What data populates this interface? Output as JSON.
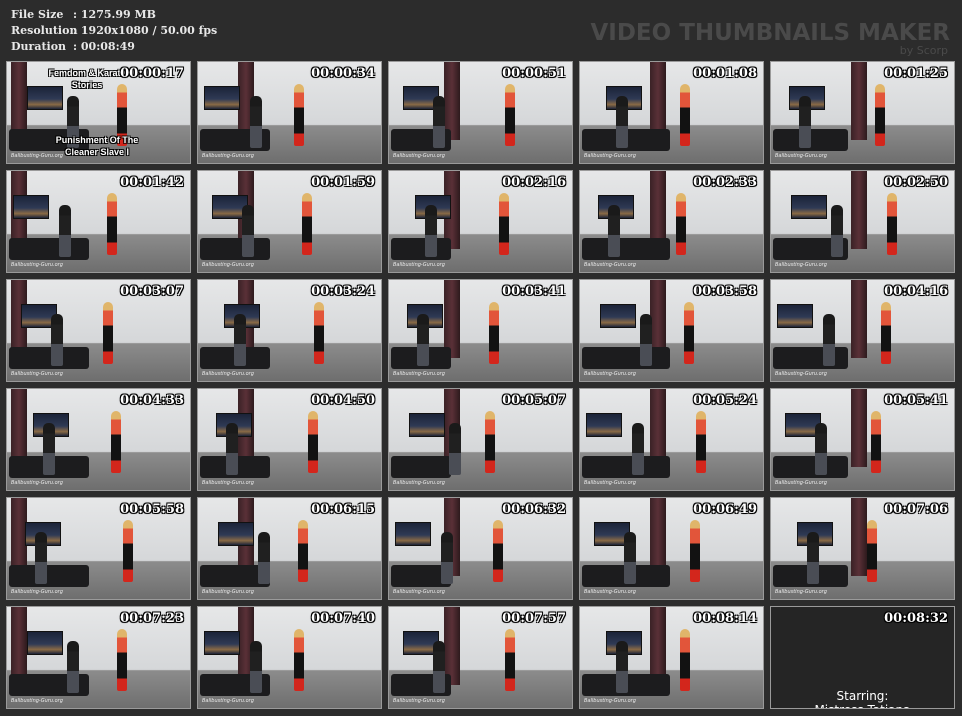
{
  "file_info": {
    "file_size_label": "File Size",
    "file_size_value": ": 1275.99 MB",
    "resolution_label": "Resolution",
    "resolution_value": ": 1920x1080 / 50.00 fps",
    "duration_label": "Duration",
    "duration_value": ": 00:08:49"
  },
  "watermark": {
    "title": "VIDEO THUMBNAILS MAKER",
    "subtitle": "by Scorp"
  },
  "first_thumb_overlay": {
    "line1": "Femdom & Karate",
    "line2": "Stories",
    "line3": "Punishment Of The",
    "line4": "Cleaner Slave I"
  },
  "site_watermark": "Ballbusting-Guru.org",
  "last_thumb": {
    "starring_label": "Starring:",
    "starring_name": "Mistress Tatiana"
  },
  "thumbnails": [
    {
      "time": "00:00:17"
    },
    {
      "time": "00:00:34"
    },
    {
      "time": "00:00:51"
    },
    {
      "time": "00:01:08"
    },
    {
      "time": "00:01:25"
    },
    {
      "time": "00:01:42"
    },
    {
      "time": "00:01:59"
    },
    {
      "time": "00:02:16"
    },
    {
      "time": "00:02:33"
    },
    {
      "time": "00:02:50"
    },
    {
      "time": "00:03:07"
    },
    {
      "time": "00:03:24"
    },
    {
      "time": "00:03:41"
    },
    {
      "time": "00:03:58"
    },
    {
      "time": "00:04:16"
    },
    {
      "time": "00:04:33"
    },
    {
      "time": "00:04:50"
    },
    {
      "time": "00:05:07"
    },
    {
      "time": "00:05:24"
    },
    {
      "time": "00:05:41"
    },
    {
      "time": "00:05:58"
    },
    {
      "time": "00:06:15"
    },
    {
      "time": "00:06:32"
    },
    {
      "time": "00:06:49"
    },
    {
      "time": "00:07:06"
    },
    {
      "time": "00:07:23"
    },
    {
      "time": "00:07:40"
    },
    {
      "time": "00:07:57"
    },
    {
      "time": "00:08:14"
    },
    {
      "time": "00:08:32"
    }
  ]
}
